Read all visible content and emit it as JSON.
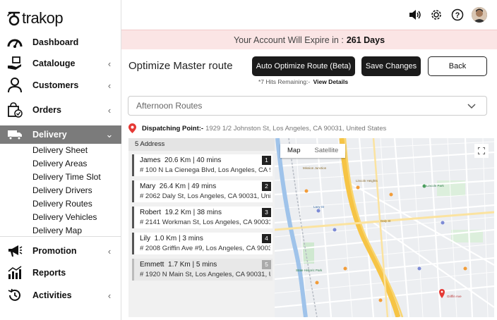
{
  "app": {
    "logo_text": "trakop"
  },
  "sidebar": {
    "items": [
      {
        "label": "Dashboard",
        "icon": "dashboard-gauge-icon"
      },
      {
        "label": "Catalouge",
        "icon": "catalogue-hand-icon"
      },
      {
        "label": "Customers",
        "icon": "user-icon"
      },
      {
        "label": "Orders",
        "icon": "shopping-bag-icon"
      },
      {
        "label": "Delivery",
        "icon": "truck-icon"
      },
      {
        "label": "Promotion",
        "icon": "megaphone-icon"
      },
      {
        "label": "Reports",
        "icon": "bar-chart-icon"
      },
      {
        "label": "Activities",
        "icon": "history-icon"
      }
    ],
    "delivery_submenu": [
      "Delivery Sheet",
      "Delivery Areas",
      "Delivery Time Slot",
      "Delivery Drivers",
      "Delivery Routes",
      "Delivery Vehicles",
      "Delivery Map"
    ]
  },
  "banner": {
    "text": "Your Account Will Expire in :",
    "days": "261 Days"
  },
  "page": {
    "title": "Optimize Master route",
    "auto_optimize_label": "Auto Optimize Route (Beta)",
    "save_label": "Save Changes",
    "back_label": "Back",
    "hits_text": "*7 Hits Remaining:-",
    "hits_link": "View Details",
    "route_select": "Afternoon Routes",
    "dispatch_label": "Dispatching Point:-",
    "dispatch_address": "1929 1/2 Johnston St, Los Angeles, CA 90031, United States"
  },
  "addresses": {
    "header": "5 Address",
    "items": [
      {
        "name": "James",
        "stats": "20.6 Km  |  40 mins",
        "address": "# 100 N La Cienega Blvd, Los Angeles, CA 90048,",
        "num": "1"
      },
      {
        "name": "Mary",
        "stats": "26.4 Km  |  49 mins",
        "address": "# 2062 Daly St, Los Angeles, CA 90031, United S",
        "num": "2"
      },
      {
        "name": "Robert",
        "stats": "19.2 Km  |  38 mins",
        "address": "# 2141 Workman St, Los Angeles, CA 90031, United",
        "num": "3"
      },
      {
        "name": "Lily",
        "stats": "1.0 Km  |  3 mins",
        "address": "# 2008 Griffin Ave #9, Los Angeles, CA 90031, U",
        "num": "4"
      },
      {
        "name": "Emmett",
        "stats": "1.7 Km  |  5 mins",
        "address": "# 1920 N Main St, Los Angeles, CA 90031, United",
        "num": "5"
      }
    ]
  },
  "map": {
    "tab_map": "Map",
    "tab_satellite": "Satellite"
  },
  "colors": {
    "banner_bg": "#fbe5e5",
    "active_nav": "#7b7b7b",
    "button_dark": "#1b1b1b",
    "pin_red": "#e53935"
  }
}
